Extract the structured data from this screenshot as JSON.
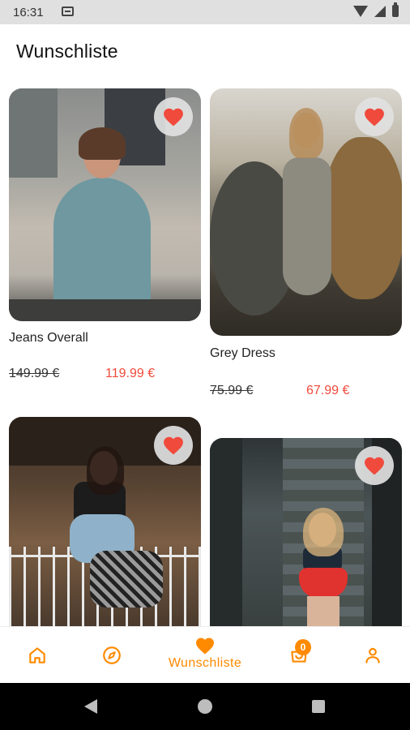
{
  "status_bar": {
    "time": "16:31"
  },
  "header": {
    "title": "Wunschliste"
  },
  "products": [
    {
      "name": "Jeans Overall",
      "old_price": "149.99 €",
      "new_price": "119.99 €",
      "favorite": true
    },
    {
      "name": "Grey Dress",
      "old_price": "75.99 €",
      "new_price": "67.99 €",
      "favorite": true
    },
    {
      "favorite": true
    },
    {
      "favorite": true
    }
  ],
  "bottom_nav": {
    "items": [
      {
        "icon": "home-icon"
      },
      {
        "icon": "compass-icon"
      },
      {
        "icon": "heart-icon",
        "label": "Wunschliste",
        "active": true
      },
      {
        "icon": "cart-icon",
        "badge": "0"
      },
      {
        "icon": "user-icon"
      }
    ]
  },
  "colors": {
    "accent": "#ff8a00",
    "sale_price": "#f04a3c",
    "favorite_heart": "#f04a3c"
  }
}
